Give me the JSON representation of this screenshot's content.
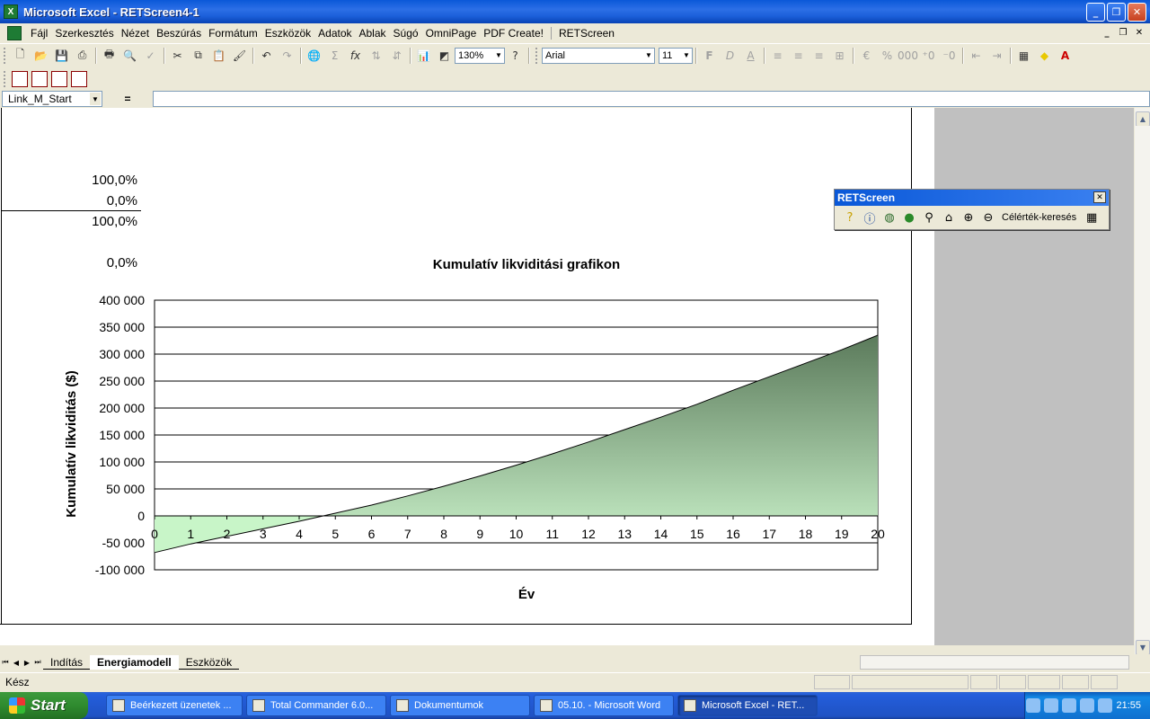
{
  "window": {
    "title": "Microsoft Excel - RETScreen4-1"
  },
  "menu": [
    "Fájl",
    "Szerkesztés",
    "Nézet",
    "Beszúrás",
    "Formátum",
    "Eszközök",
    "Adatok",
    "Ablak",
    "Súgó",
    "OmniPage",
    "PDF Create!",
    "RETScreen"
  ],
  "toolbar": {
    "zoom": "130%",
    "font_name": "Arial",
    "font_size": "11"
  },
  "formula_bar": {
    "name_box": "Link_M_Start",
    "equals": "="
  },
  "sheet": {
    "pct_1": "100,0%",
    "pct_2": "0,0%",
    "pct_3": "100,0%",
    "pct_4": "0,0%"
  },
  "rets_toolbar": {
    "title": "RETScreen",
    "goal_seek_label": "Célérték-keresés"
  },
  "tabs": [
    "Indítás",
    "Energiamodell",
    "Eszközök"
  ],
  "active_tab": "Energiamodell",
  "status": {
    "text": "Kész"
  },
  "taskbar": {
    "start": "Start",
    "buttons": [
      "Beérkezett üzenetek ...",
      "Total Commander 6.0...",
      "Dokumentumok",
      "05.10. - Microsoft Word",
      "Microsoft Excel - RET..."
    ],
    "clock": "21:55"
  },
  "colors": {
    "fill_top": "#5B7A5B",
    "fill_bottom": "#CDF5CD",
    "neg_fill": "#C8F5C8"
  },
  "chart_data": {
    "type": "area",
    "title": "Kumulatív likviditási grafikon",
    "xlabel": "Év",
    "ylabel": "Kumulatív likviditás ($)",
    "x": [
      0,
      1,
      2,
      3,
      4,
      5,
      6,
      7,
      8,
      9,
      10,
      11,
      12,
      13,
      14,
      15,
      16,
      17,
      18,
      19,
      20
    ],
    "values": [
      -68000,
      -52000,
      -38000,
      -24000,
      -10000,
      5000,
      20000,
      37000,
      55000,
      74000,
      94000,
      115000,
      137000,
      160000,
      183000,
      207000,
      233000,
      258000,
      283000,
      308000,
      335000
    ],
    "x_tick_labels": [
      "0",
      "1",
      "2",
      "3",
      "4",
      "5",
      "6",
      "7",
      "8",
      "9",
      "10",
      "11",
      "12",
      "13",
      "14",
      "15",
      "16",
      "17",
      "18",
      "19",
      "20"
    ],
    "y_tick_labels": [
      "400 000",
      "350 000",
      "300 000",
      "250 000",
      "200 000",
      "150 000",
      "100 000",
      "50 000",
      "0",
      "-50 000",
      "-100 000"
    ],
    "y_ticks": [
      400000,
      350000,
      300000,
      250000,
      200000,
      150000,
      100000,
      50000,
      0,
      -50000,
      -100000
    ],
    "ylim": [
      -100000,
      400000
    ],
    "xlim": [
      0,
      20
    ],
    "grid": true
  }
}
